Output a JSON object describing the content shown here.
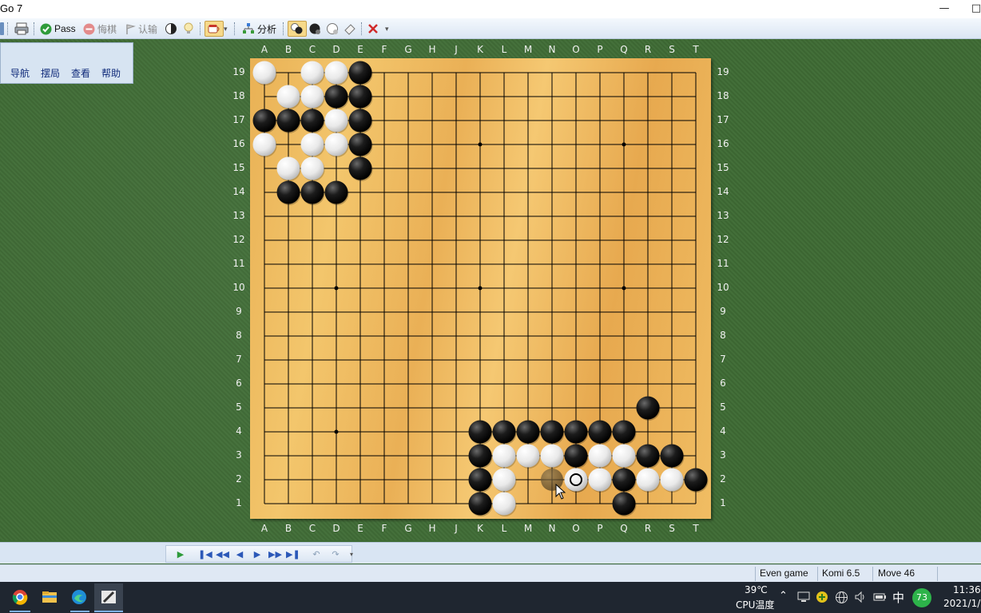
{
  "window": {
    "title": "Go 7"
  },
  "toolbar": {
    "pass_label": "Pass",
    "undo_label": "悔棋",
    "resign_label": "认输",
    "analyze_label": "分析"
  },
  "sidepanel": {
    "tabs": [
      "导航",
      "摆局",
      "查看",
      "帮助"
    ]
  },
  "board": {
    "size": 19,
    "columns": [
      "A",
      "B",
      "C",
      "D",
      "E",
      "F",
      "G",
      "H",
      "J",
      "K",
      "L",
      "M",
      "N",
      "O",
      "P",
      "Q",
      "R",
      "S",
      "T"
    ],
    "rows": [
      "19",
      "18",
      "17",
      "16",
      "15",
      "14",
      "13",
      "12",
      "11",
      "10",
      "9",
      "8",
      "7",
      "6",
      "5",
      "4",
      "3",
      "2",
      "1"
    ],
    "black_stones": [
      "E19",
      "D18",
      "E18",
      "A17",
      "B17",
      "C17",
      "E17",
      "E16",
      "E15",
      "B14",
      "C14",
      "D14",
      "R5",
      "K4",
      "L4",
      "M4",
      "N4",
      "O4",
      "P4",
      "Q4",
      "K3",
      "O3",
      "R3",
      "S3",
      "K2",
      "Q2",
      "T2",
      "K1",
      "Q1"
    ],
    "white_stones": [
      "A19",
      "C19",
      "D19",
      "B18",
      "C18",
      "D17",
      "A16",
      "C16",
      "D16",
      "B15",
      "C15",
      "L3",
      "M3",
      "N3",
      "P3",
      "Q3",
      "L2",
      "O2",
      "P2",
      "R2",
      "S2",
      "L1"
    ],
    "last_move": "O2",
    "hover_point": "N2",
    "colors": {
      "line": "#000000",
      "coord_text": "#f1f1f1",
      "board_light": "#f3c66c",
      "board_dark": "#e7a94f"
    }
  },
  "status": {
    "game_type": "Even game",
    "komi": "Komi 6.5",
    "move": "Move 46"
  },
  "taskbar": {
    "temperature": "39℃",
    "temp_label": "CPU温度",
    "ime": "中",
    "badge": "73",
    "time": "11:36",
    "date": "2021/1/"
  }
}
